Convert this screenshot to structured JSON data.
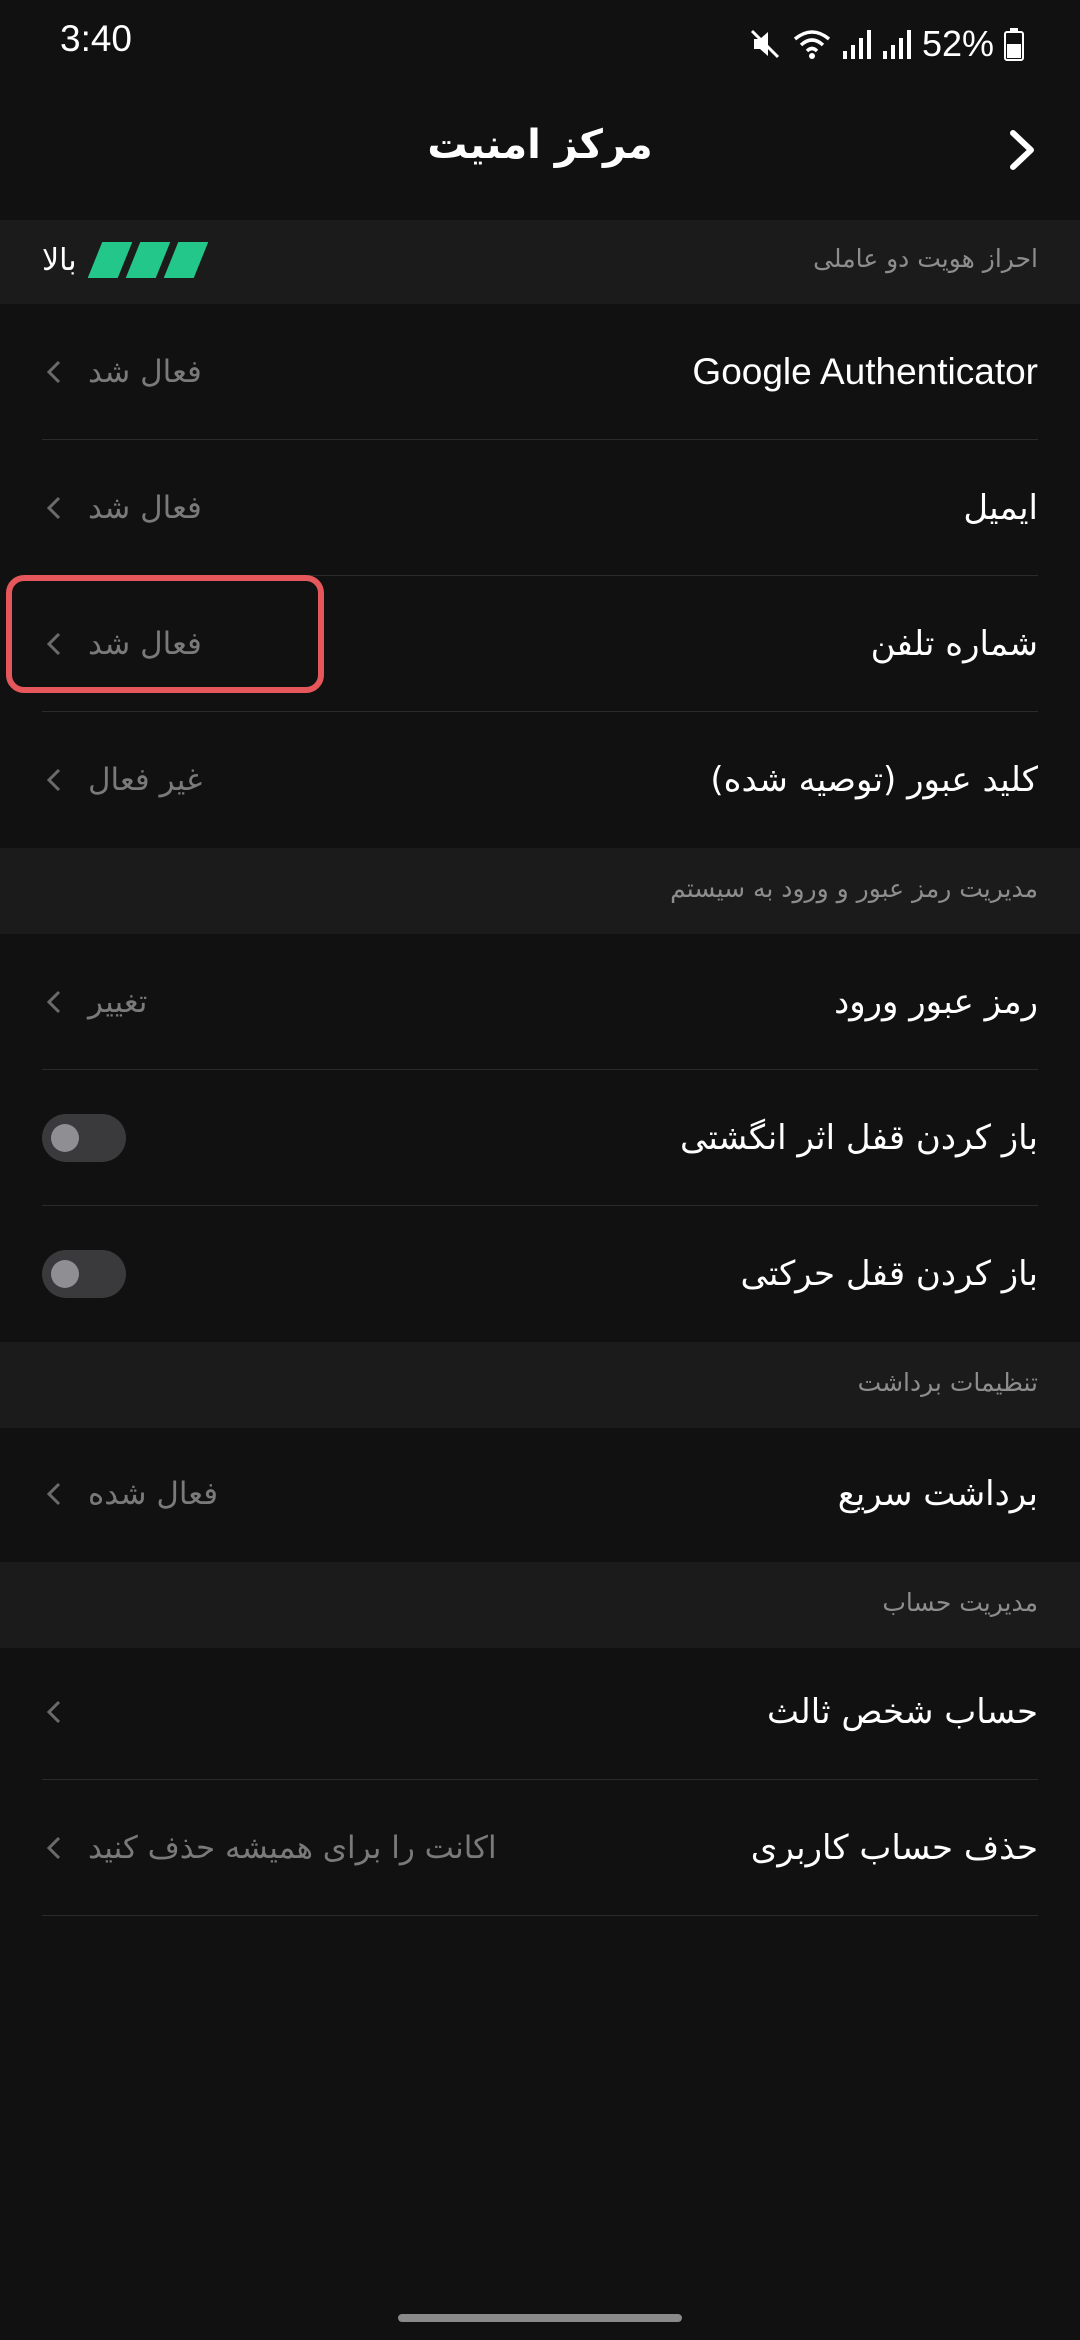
{
  "status_bar": {
    "time": "3:40",
    "battery": "52%",
    "icons": [
      "mute-icon",
      "wifi-icon",
      "signal-icon",
      "signal-icon",
      "battery-icon"
    ]
  },
  "header": {
    "title": "مرکز امنیت",
    "back_icon": "chevron-right-icon"
  },
  "two_factor": {
    "section_label": "احراز هویت دو عاملی",
    "level_label": "بالا",
    "level_color": "#24c78a",
    "items": [
      {
        "title": "Google Authenticator",
        "value": "فعال شد"
      },
      {
        "title": "ایمیل",
        "value": "فعال شد"
      },
      {
        "title": "شماره تلفن",
        "value": "فعال شد"
      },
      {
        "title": "کلید عبور (توصیه شده)",
        "value": "غیر فعال"
      }
    ]
  },
  "password_section": {
    "section_label": "مدیریت رمز عبور و ورود به سیستم",
    "login_password": {
      "title": "رمز عبور ورود",
      "value": "تغییر"
    },
    "fingerprint": {
      "title": "باز کردن قفل اثر انگشتی",
      "enabled": false
    },
    "gesture": {
      "title": "باز کردن قفل حرکتی",
      "enabled": false
    }
  },
  "withdraw_section": {
    "section_label": "تنظیمات برداشت",
    "quick_withdraw": {
      "title": "برداشت سریع",
      "value": "فعال شده"
    }
  },
  "account_section": {
    "section_label": "مدیریت حساب",
    "third_party": {
      "title": "حساب شخص ثالث",
      "value": ""
    },
    "delete_account": {
      "title": "حذف حساب کاربری",
      "value": "اکانت را برای همیشه حذف کنید"
    }
  },
  "colors": {
    "background": "#111111",
    "section_background": "#1b1b1b",
    "highlight": "#e5575a"
  }
}
